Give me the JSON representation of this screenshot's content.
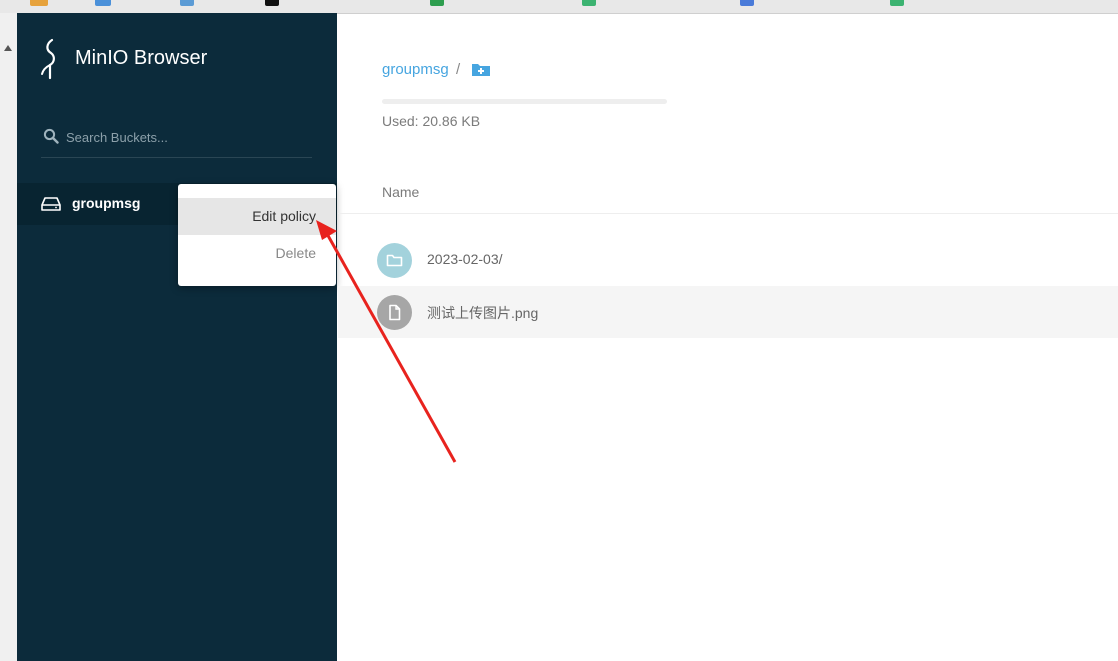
{
  "app": {
    "title": "MinIO Browser"
  },
  "search": {
    "placeholder": "Search Buckets..."
  },
  "buckets": [
    {
      "label": "groupmsg"
    }
  ],
  "context_menu": {
    "edit_policy": "Edit policy",
    "delete": "Delete"
  },
  "breadcrumb": {
    "bucket": "groupmsg",
    "separator": "/"
  },
  "storage": {
    "used": "Used: 20.86 KB",
    "usage_fraction": 0.0
  },
  "table": {
    "columns": [
      "Name"
    ],
    "rows": [
      {
        "name": "2023-02-03/",
        "icon": "folder-icon"
      },
      {
        "name": "测试上传图片.png",
        "icon": "file-icon"
      }
    ]
  },
  "colors": {
    "sidebar": "#0c2b3b",
    "accent": "#46a5e0",
    "annotation_arrow": "#e8231e"
  }
}
